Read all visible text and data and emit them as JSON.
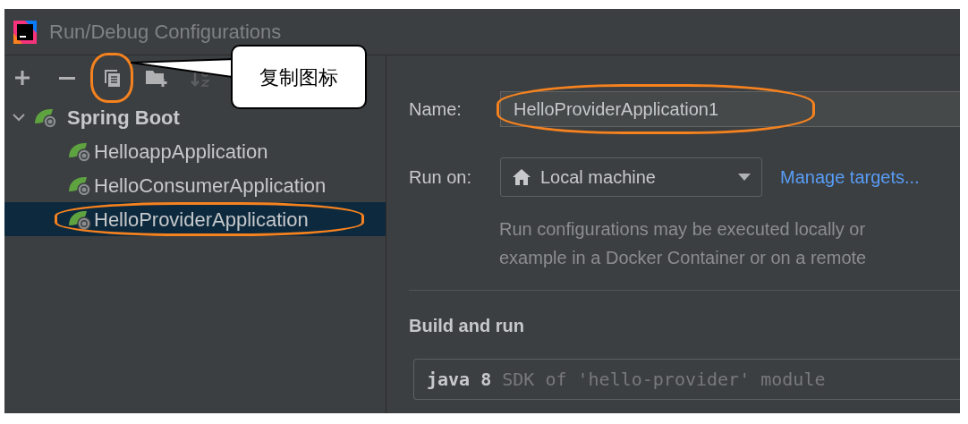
{
  "window": {
    "title": "Run/Debug Configurations"
  },
  "toolbar": [
    {
      "kind": "add",
      "disabled": false,
      "annotated": false
    },
    {
      "kind": "remove",
      "disabled": false,
      "annotated": false
    },
    {
      "kind": "copy",
      "disabled": false,
      "annotated": true
    },
    {
      "kind": "folder",
      "disabled": false,
      "annotated": false
    },
    {
      "kind": "sort",
      "disabled": true,
      "annotated": false
    }
  ],
  "callout": {
    "text": "复制图标"
  },
  "tree": [
    {
      "label": "Spring Boot",
      "expanded": true,
      "children": [
        {
          "label": "HelloappApplication",
          "selected": false,
          "annotated": false
        },
        {
          "label": "HelloConsumerApplication",
          "selected": false,
          "annotated": false
        },
        {
          "label": "HelloProviderApplication",
          "selected": true,
          "annotated": true
        }
      ]
    }
  ],
  "form": {
    "name_label": "Name:",
    "name_value": "HelloProviderApplication1",
    "name_annotated": true,
    "run_on_label": "Run on:",
    "run_on_value": "Local machine",
    "manage_link": "Manage targets...",
    "hint_lines": [
      "Run configurations may be executed locally or",
      "example in a Docker Container or on a remote"
    ],
    "section_title": "Build and run",
    "sdk": {
      "value": "java 8",
      "hint": "SDK of 'hello-provider' module"
    }
  }
}
